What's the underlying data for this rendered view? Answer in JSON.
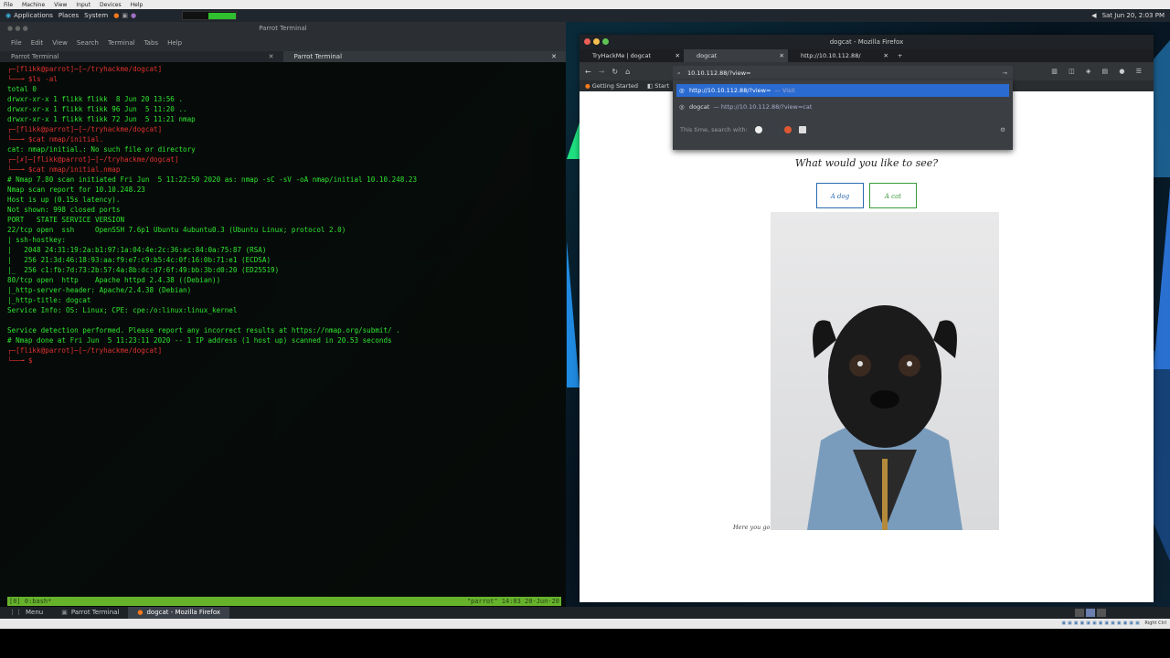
{
  "vm_menu": [
    "File",
    "Machine",
    "View",
    "Input",
    "Devices",
    "Help"
  ],
  "panel": {
    "applications": "Applications",
    "places": "Places",
    "system": "System",
    "clock": "Sat Jun 20, 2:03 PM"
  },
  "terminal": {
    "window_title": "Parrot Terminal",
    "menu": [
      "File",
      "Edit",
      "View",
      "Search",
      "Terminal",
      "Tabs",
      "Help"
    ],
    "tabs": [
      "Parrot Terminal",
      "Parrot Terminal"
    ],
    "lines": [
      {
        "c": "red",
        "t": "┌─[flikk@parrot]─[~/tryhackme/dogcat]"
      },
      {
        "c": "red",
        "t": "└──╼ $ls -al"
      },
      {
        "c": "g",
        "t": "total 0"
      },
      {
        "c": "g",
        "t": "drwxr-xr-x 1 flikk flikk  8 Jun 20 13:56 ."
      },
      {
        "c": "g",
        "t": "drwxr-xr-x 1 flikk flikk 96 Jun  5 11:20 .."
      },
      {
        "c": "g",
        "t": "drwxr-xr-x 1 flikk flikk 72 Jun  5 11:21 nmap"
      },
      {
        "c": "red",
        "t": "┌─[flikk@parrot]─[~/tryhackme/dogcat]"
      },
      {
        "c": "red",
        "t": "└──╼ $cat nmap/initial."
      },
      {
        "c": "g",
        "t": "cat: nmap/initial.: No such file or directory"
      },
      {
        "c": "red",
        "t": "┌─[✗]─[flikk@parrot]─[~/tryhackme/dogcat]"
      },
      {
        "c": "red",
        "t": "└──╼ $cat nmap/initial.nmap"
      },
      {
        "c": "g",
        "t": "# Nmap 7.80 scan initiated Fri Jun  5 11:22:50 2020 as: nmap -sC -sV -oA nmap/initial 10.10.248.23"
      },
      {
        "c": "g",
        "t": "Nmap scan report for 10.10.248.23"
      },
      {
        "c": "g",
        "t": "Host is up (0.15s latency)."
      },
      {
        "c": "g",
        "t": "Not shown: 998 closed ports"
      },
      {
        "c": "g",
        "t": "PORT   STATE SERVICE VERSION"
      },
      {
        "c": "g",
        "t": "22/tcp open  ssh     OpenSSH 7.6p1 Ubuntu 4ubuntu0.3 (Ubuntu Linux; protocol 2.0)"
      },
      {
        "c": "g",
        "t": "| ssh-hostkey:"
      },
      {
        "c": "g",
        "t": "|   2048 24:31:19:2a:b1:97:1a:04:4e:2c:36:ac:84:0a:75:87 (RSA)"
      },
      {
        "c": "g",
        "t": "|   256 21:3d:46:18:93:aa:f9:e7:c9:b5:4c:0f:16:0b:71:e1 (ECDSA)"
      },
      {
        "c": "g",
        "t": "|_  256 c1:fb:7d:73:2b:57:4a:8b:dc:d7:6f:49:bb:3b:d0:20 (ED25519)"
      },
      {
        "c": "g",
        "t": "80/tcp open  http    Apache httpd 2.4.38 ((Debian))"
      },
      {
        "c": "g",
        "t": "|_http-server-header: Apache/2.4.38 (Debian)"
      },
      {
        "c": "g",
        "t": "|_http-title: dogcat"
      },
      {
        "c": "g",
        "t": "Service Info: OS: Linux; CPE: cpe:/o:linux:linux_kernel"
      },
      {
        "c": "g",
        "t": " "
      },
      {
        "c": "g",
        "t": "Service detection performed. Please report any incorrect results at https://nmap.org/submit/ ."
      },
      {
        "c": "g",
        "t": "# Nmap done at Fri Jun  5 11:23:11 2020 -- 1 IP address (1 host up) scanned in 20.53 seconds"
      },
      {
        "c": "red",
        "t": "┌─[flikk@parrot]─[~/tryhackme/dogcat]"
      },
      {
        "c": "red",
        "t": "└──╼ $"
      }
    ],
    "tmux_left": "[0] 0:bash*",
    "tmux_right": "\"parrot\" 14:03 20-Jun-20"
  },
  "firefox": {
    "window_title": "dogcat - Mozilla Firefox",
    "tabs": [
      "TryHackMe | dogcat",
      "dogcat",
      "http://10.10.112.88/"
    ],
    "url_typed": "10.10.112.88/?view=",
    "bookmarks": [
      "Getting Started",
      "Start"
    ],
    "suggestions": [
      {
        "main": "http://10.10.112.88/?view=",
        "sub": "— Visit"
      },
      {
        "main": "dogcat",
        "sub": "— http://10.10.112.88/?view=cat"
      }
    ],
    "search_with": "This time, search with:",
    "page": {
      "question": "What would you like to see?",
      "btn_dog": "A dog",
      "btn_cat": "A cat",
      "caption": "Here you go!"
    }
  },
  "taskbar": {
    "menu": "Menu",
    "items": [
      "Parrot Terminal",
      "dogcat - Mozilla Firefox"
    ]
  },
  "vm_status": "Right Ctrl"
}
